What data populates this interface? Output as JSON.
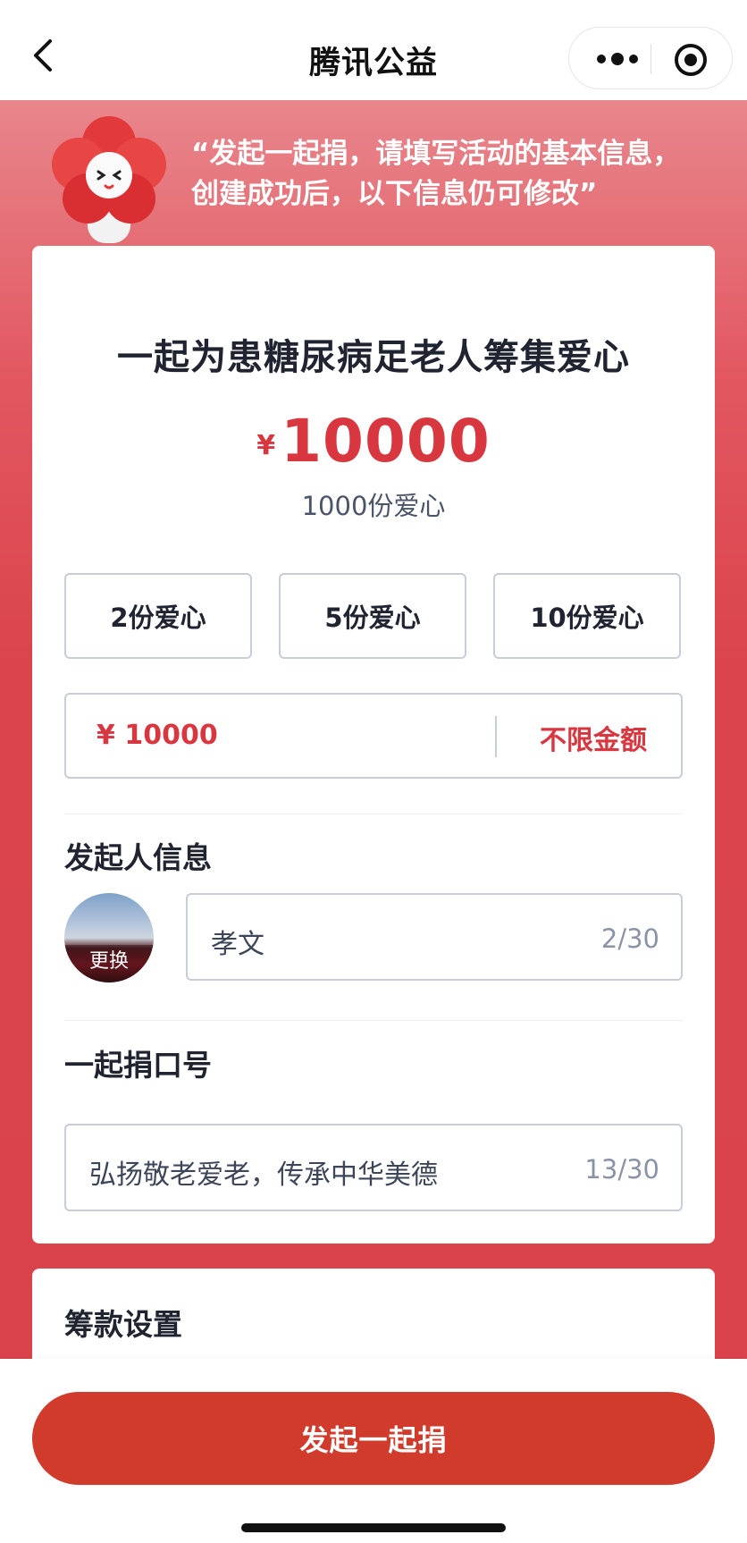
{
  "nav": {
    "title": "腾讯公益",
    "icons": [
      "back-arrow-icon",
      "more-dots-icon",
      "close-target-icon"
    ]
  },
  "intro": {
    "line1": "“发起一起捐，请填写活动的基本信息，",
    "line2": "创建成功后，以下信息仍可修改”"
  },
  "campaign": {
    "title": "一起为患糖尿病足老人筹集爱心",
    "currency_symbol": "¥",
    "amount": "10000",
    "share_count": "1000份爱心"
  },
  "options": [
    {
      "label": "2份爱心"
    },
    {
      "label": "5份爱心"
    },
    {
      "label": "10份爱心"
    }
  ],
  "custom_amount": {
    "value": "¥ 10000",
    "unlimited_label": "不限金额"
  },
  "initiator": {
    "section_label": "发起人信息",
    "avatar_label": "更换",
    "name_value": "孝文",
    "name_count": "2/30"
  },
  "slogan": {
    "section_label": "一起捐口号",
    "value": "弘扬敬老爱老，传承中华美德",
    "count": "13/30"
  },
  "settings": {
    "title": "筹款设置"
  },
  "action": {
    "primary_label": "发起一起捐"
  },
  "colors": {
    "brand_red": "#d8373f",
    "button_red": "#d03b2c",
    "background_red": "#db444c"
  }
}
